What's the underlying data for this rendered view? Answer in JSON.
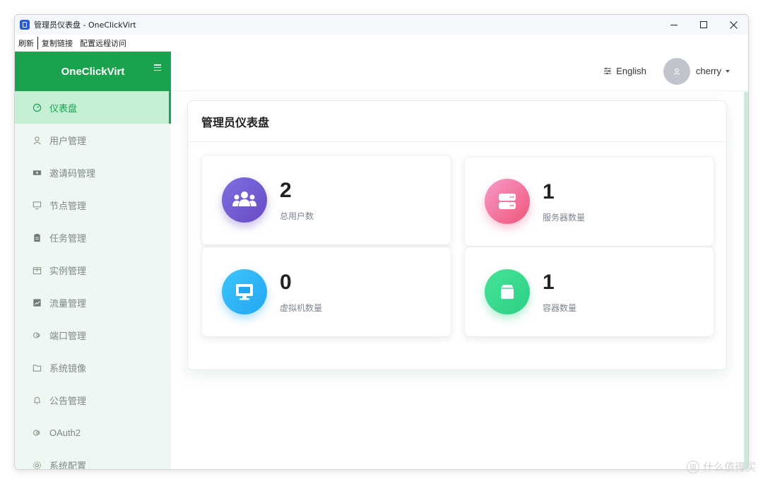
{
  "window": {
    "title": "管理员仪表盘 - OneClickVirt"
  },
  "menubar": {
    "items": [
      "刷新",
      "复制链接",
      "配置远程访问"
    ]
  },
  "sidebar": {
    "brand": "OneClickVirt",
    "items": [
      {
        "label": "仪表盘",
        "icon": "dashboard-icon",
        "active": true
      },
      {
        "label": "用户管理",
        "icon": "user-icon"
      },
      {
        "label": "邀请码管理",
        "icon": "ticket-icon"
      },
      {
        "label": "节点管理",
        "icon": "monitor-icon"
      },
      {
        "label": "任务管理",
        "icon": "clipboard-icon"
      },
      {
        "label": "实例管理",
        "icon": "box-icon"
      },
      {
        "label": "流量管理",
        "icon": "chart-icon"
      },
      {
        "label": "端口管理",
        "icon": "link-icon"
      },
      {
        "label": "系统镜像",
        "icon": "folder-icon"
      },
      {
        "label": "公告管理",
        "icon": "bell-icon"
      },
      {
        "label": "OAuth2",
        "icon": "link-icon"
      },
      {
        "label": "系统配置",
        "icon": "gear-icon"
      }
    ]
  },
  "header": {
    "language": "English",
    "username": "cherry"
  },
  "dashboard": {
    "title": "管理员仪表盘",
    "stats": [
      {
        "value": "2",
        "label": "总用户数",
        "icon": "users-icon",
        "gradient": [
          "#7c6fe0",
          "#6a4bc4"
        ]
      },
      {
        "value": "1",
        "label": "服务器数量",
        "icon": "server-icon",
        "gradient": [
          "#f59ac8",
          "#f0567a"
        ]
      },
      {
        "value": "0",
        "label": "虚拟机数量",
        "icon": "monitor-icon",
        "gradient": [
          "#3fc5fb",
          "#21a6f3"
        ]
      },
      {
        "value": "1",
        "label": "容器数量",
        "icon": "container-icon",
        "gradient": [
          "#45e39a",
          "#2dcf85"
        ]
      }
    ]
  },
  "watermark": "什么值得买",
  "colors": {
    "brand": "#1aa24f",
    "sidebar_bg": "#eef7f1",
    "active_bg": "#c5f0d3"
  }
}
